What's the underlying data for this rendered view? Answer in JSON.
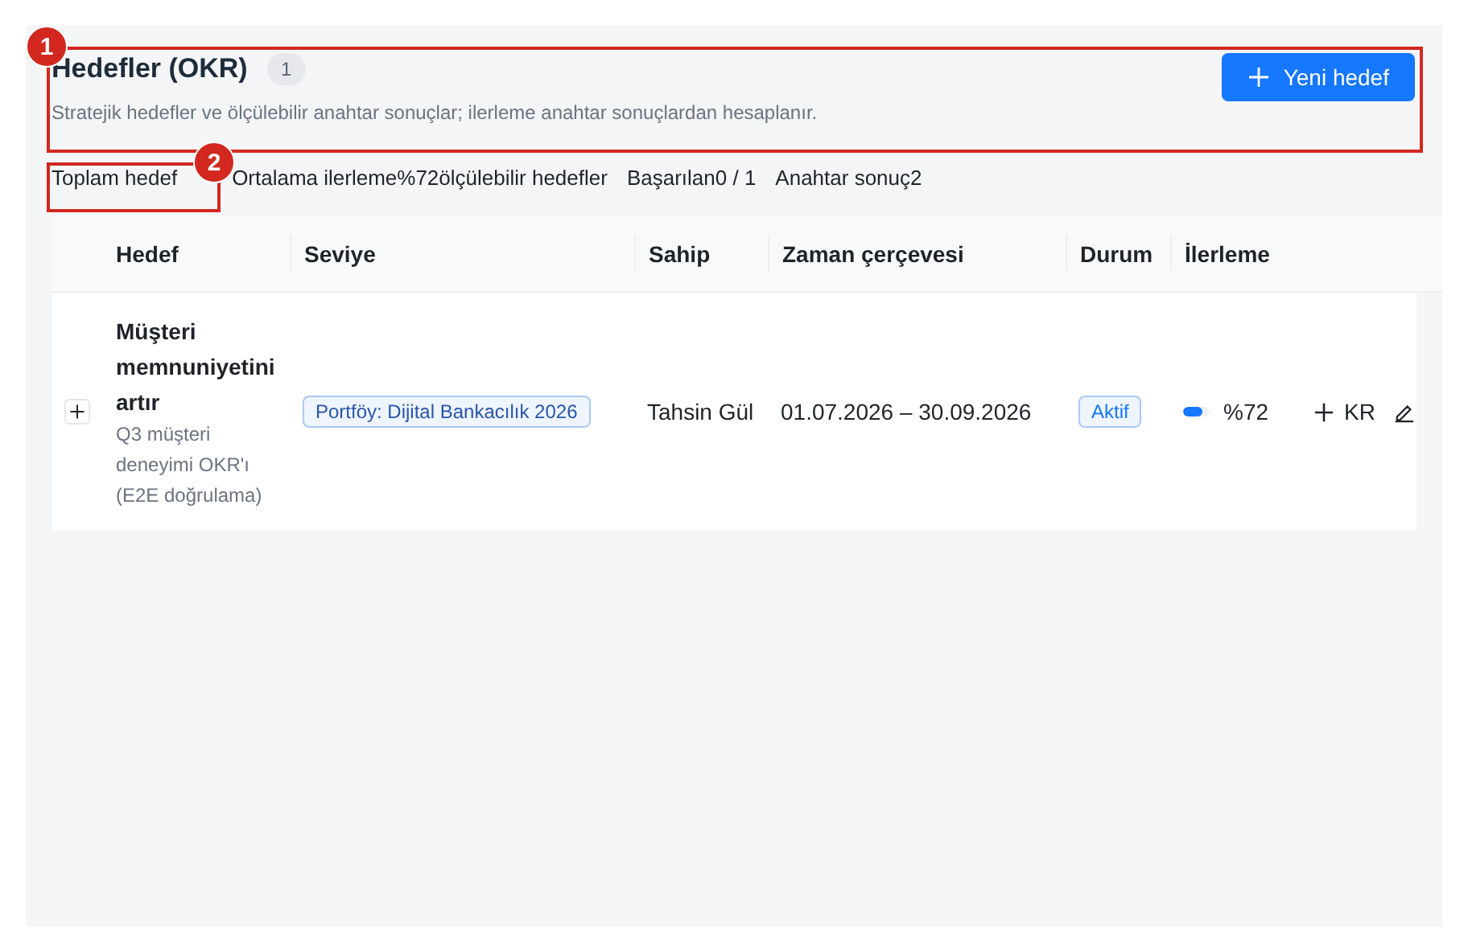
{
  "header": {
    "title": "Hedefler (OKR)",
    "count": "1",
    "subtitle": "Stratejik hedefler ve ölçülebilir anahtar sonuçlar; ilerleme anahtar sonuçlardan hesaplanır.",
    "new_button": "Yeni hedef"
  },
  "stats": [
    "Toplam hedef",
    "Ortalama ilerleme%72ölçülebilir hedefler",
    "Başarılan0 / 1",
    "Anahtar sonuç2"
  ],
  "table": {
    "columns": [
      "Hedef",
      "Seviye",
      "Sahip",
      "Zaman çerçevesi",
      "Durum",
      "İlerleme"
    ],
    "rows": [
      {
        "expanded": false,
        "title": "Müşteri memnuniyetini artır",
        "description": "Q3 müşteri deneyimi OKR'ı (E2E doğrulama)",
        "level": "Portföy: Dijital Bankacılık 2026",
        "owner": "Tahsin Gül",
        "timeframe": "01.07.2026 – 30.09.2026",
        "status": "Aktif",
        "progress": {
          "level": 0.72,
          "reading": "%72"
        },
        "add_kr": "KR"
      }
    ]
  },
  "annotations": [
    {
      "number": "1"
    },
    {
      "number": "2"
    }
  ]
}
